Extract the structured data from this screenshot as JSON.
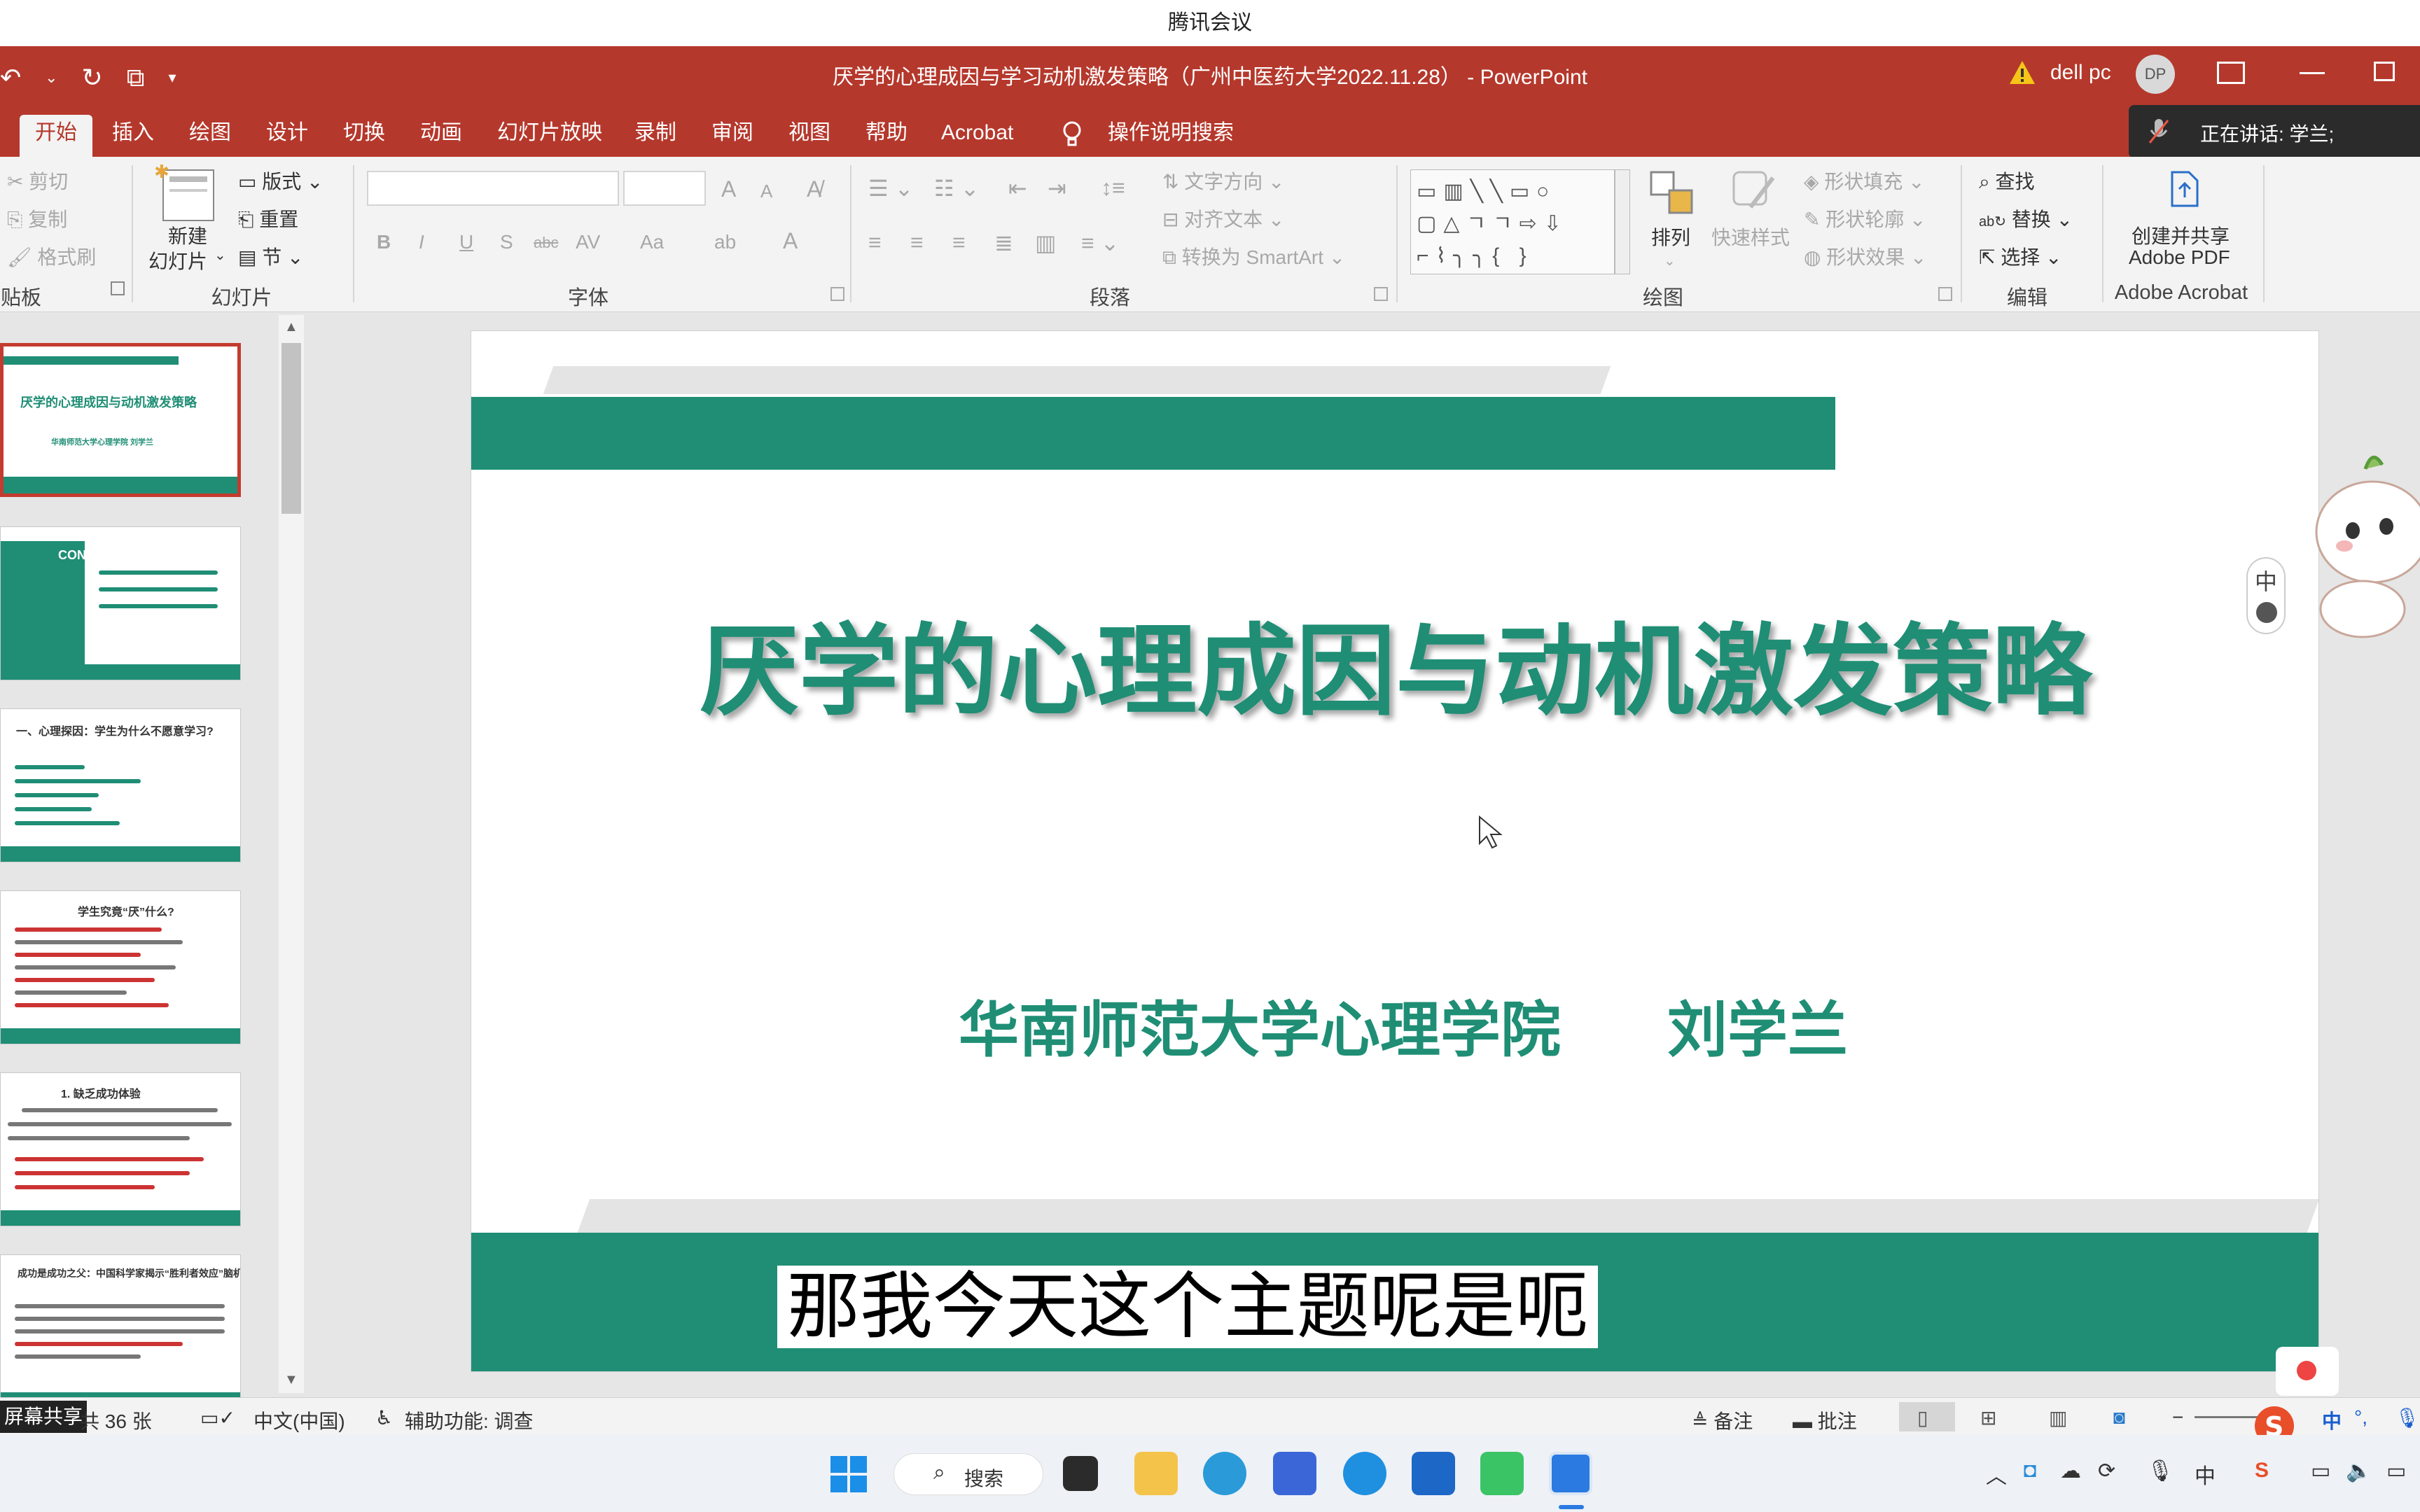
{
  "meeting": {
    "app_title": "腾讯会议",
    "speaking_label": "正在讲话: 学兰;",
    "screen_share_label": "屏幕共享"
  },
  "window": {
    "title": "厌学的心理成因与学习动机激发策略（广州中医药大学2022.11.28） - PowerPoint",
    "user_name": "dell pc",
    "user_initials": "DP",
    "warning_icon": "warning-icon"
  },
  "tabs": [
    "开始",
    "插入",
    "绘图",
    "设计",
    "切换",
    "动画",
    "幻灯片放映",
    "录制",
    "审阅",
    "视图",
    "帮助",
    "Acrobat",
    "操作说明搜索"
  ],
  "ribbon": {
    "clipboard": {
      "cut": "剪切",
      "copy": "复制",
      "format_painter": "格式刷",
      "label": "贴板"
    },
    "slides": {
      "new_slide": "新建",
      "new_slide2": "幻灯片",
      "layout": "版式",
      "reset": "重置",
      "section": "节",
      "label": "幻灯片"
    },
    "font": {
      "bold": "B",
      "italic": "I",
      "underline": "U",
      "shadow": "S",
      "strike": "abc",
      "spacing": "AV",
      "case": "Aa",
      "grow": "A",
      "shrink": "A",
      "label": "字体"
    },
    "paragraph": {
      "text_direction": "文字方向",
      "align_text": "对齐文本",
      "smartart": "转换为 SmartArt",
      "label": "段落"
    },
    "drawing": {
      "arrange": "排列",
      "quick_styles": "快速样式",
      "shape_fill": "形状填充",
      "shape_outline": "形状轮廓",
      "shape_effects": "形状效果",
      "label": "绘图"
    },
    "editing": {
      "find": "查找",
      "replace": "替换",
      "select": "选择",
      "label": "编辑"
    },
    "acrobat": {
      "create_share": "创建并共享",
      "adobe_pdf": "Adobe PDF",
      "label": "Adobe Acrobat"
    }
  },
  "thumbnails": [
    {
      "title": "厌学的心理成因与动机激发策略",
      "subtitle": "华南师范大学心理学院    刘学兰"
    },
    {
      "title": "CONTENTS"
    },
    {
      "title": "一、心理探因：学生为什么不愿意学习?"
    },
    {
      "title": "学生究竟“厌”什么?"
    },
    {
      "title": "1. 缺乏成功体验"
    },
    {
      "title": "成功是成功之父：中国科学家揭示“胜利者效应”脑机制"
    }
  ],
  "slide": {
    "title": "厌学的心理成因与动机激发策略",
    "institution": "华南师范大学心理学院",
    "author": "刘学兰"
  },
  "subtitle_caption": "那我今天这个主题呢是呃",
  "ime": {
    "lang": "中"
  },
  "status": {
    "slide_count": "共 36 张",
    "language": "中文(中国)",
    "accessibility": "辅助功能: 调查",
    "notes": "备注",
    "comments": "批注"
  },
  "taskbar": {
    "search": "搜索",
    "ime_lang": "中"
  },
  "colors": {
    "powerpoint_red": "#b5382c",
    "slide_green": "#1f8e75",
    "ribbon_bg": "#f3f3f3"
  }
}
